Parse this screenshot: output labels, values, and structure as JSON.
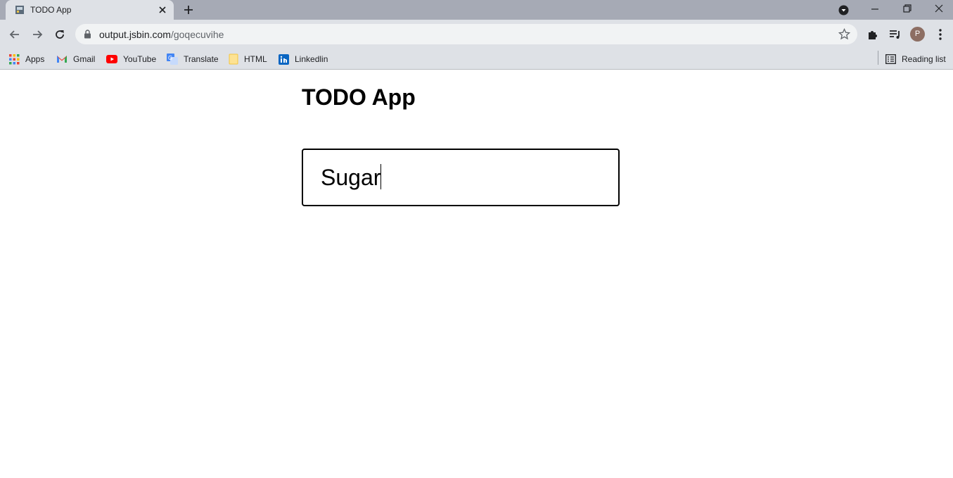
{
  "browser": {
    "tab": {
      "title": "TODO App"
    },
    "address": {
      "host": "output.jsbin.com",
      "path": "/goqecuvihe"
    },
    "profile_initial": "P",
    "bookmarks": [
      {
        "label": "Apps",
        "icon": "apps-grid-icon"
      },
      {
        "label": "Gmail",
        "icon": "gmail-icon"
      },
      {
        "label": "YouTube",
        "icon": "youtube-icon"
      },
      {
        "label": "Translate",
        "icon": "translate-icon"
      },
      {
        "label": "HTML",
        "icon": "folder-icon"
      },
      {
        "label": "Linkedlin",
        "icon": "linkedin-icon"
      }
    ],
    "reading_list": "Reading list"
  },
  "app": {
    "title": "TODO App",
    "input_value": "Sugar"
  }
}
